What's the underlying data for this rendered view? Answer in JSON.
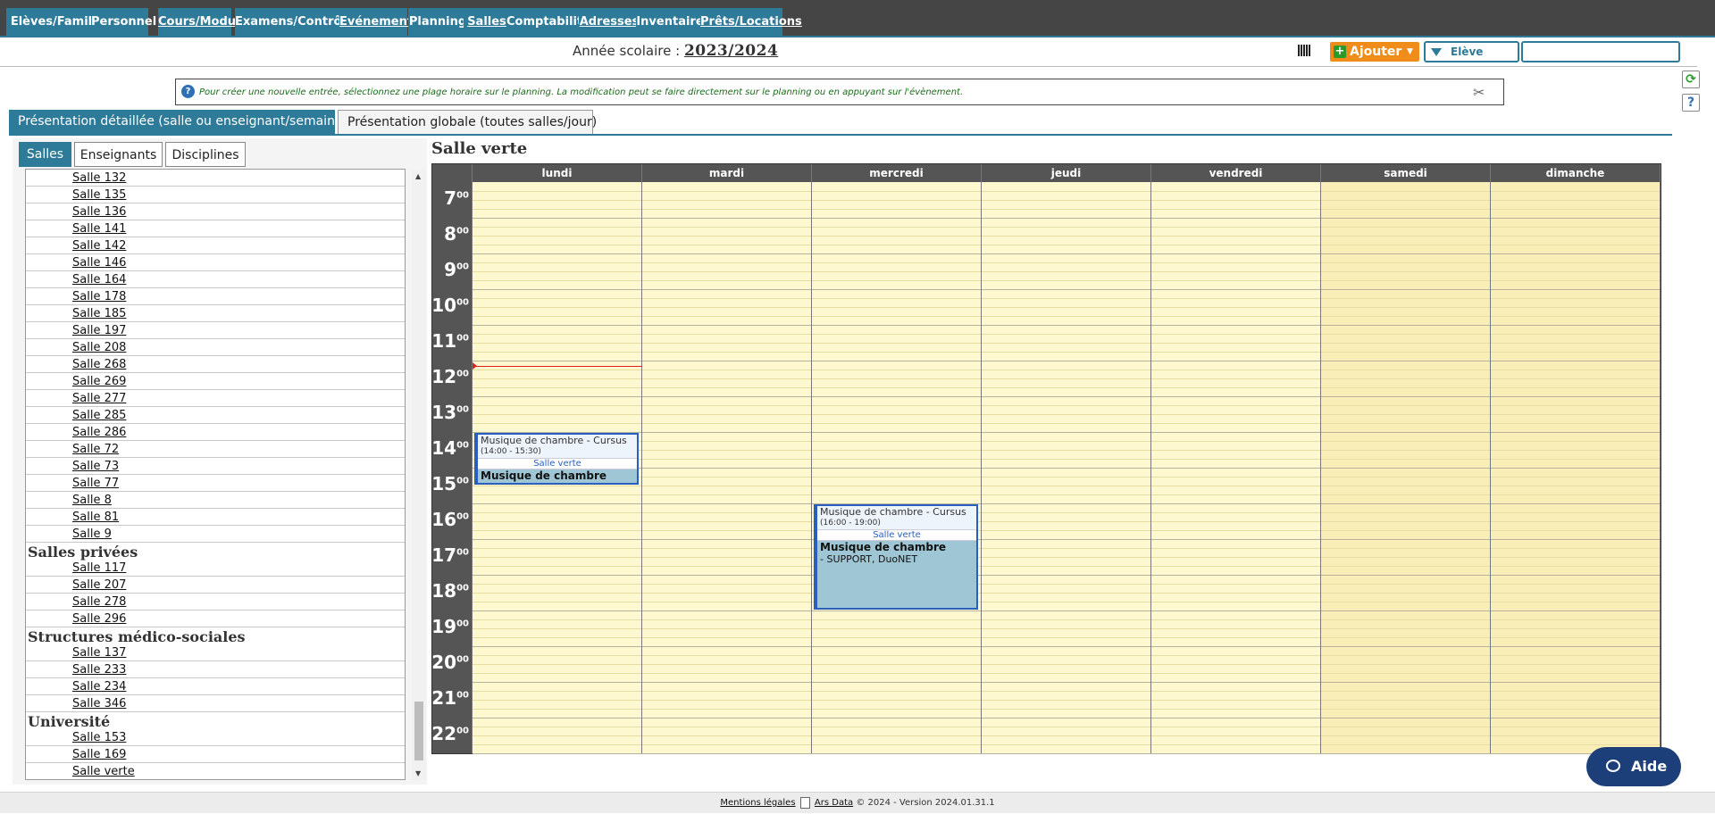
{
  "nav": {
    "tabs": [
      {
        "label": "Elèves/Familles",
        "underline": false
      },
      {
        "label": "Personnel",
        "underline": false
      },
      {
        "label": "Cours/Modules",
        "underline": true
      },
      {
        "label": "Examens/Contrôles",
        "underline": false
      },
      {
        "label": "Evénements",
        "underline": true
      },
      {
        "label": "Planning",
        "underline": false
      },
      {
        "label": "Salles",
        "underline": true
      },
      {
        "label": "Comptabilité",
        "underline": false
      },
      {
        "label": "Adresses",
        "underline": true
      },
      {
        "label": "Inventaire",
        "underline": false
      },
      {
        "label": "Prêts/Locations",
        "underline": true
      }
    ]
  },
  "header": {
    "year_label": "Année scolaire :",
    "year_value": "2023/2024",
    "add_label": "Ajouter",
    "search_type": "Elève",
    "search_value": ""
  },
  "info": {
    "text": "Pour créer une nouvelle entrée, sélectionnez une plage horaire sur le planning. La modification peut se faire directement sur le planning ou en appuyant sur l'évènement."
  },
  "view_tabs": {
    "detailed": "Présentation détaillée (salle ou enseignant/semaine)",
    "global": "Présentation globale (toutes salles/jour)"
  },
  "side_tabs": {
    "rooms": "Salles",
    "teachers": "Enseignants",
    "disciplines": "Disciplines"
  },
  "room_list": [
    {
      "type": "room",
      "label": "Salle 132"
    },
    {
      "type": "room",
      "label": "Salle 135"
    },
    {
      "type": "room",
      "label": "Salle 136"
    },
    {
      "type": "room",
      "label": "Salle 141"
    },
    {
      "type": "room",
      "label": "Salle 142"
    },
    {
      "type": "room",
      "label": "Salle 146"
    },
    {
      "type": "room",
      "label": "Salle 164"
    },
    {
      "type": "room",
      "label": "Salle 178"
    },
    {
      "type": "room",
      "label": "Salle 185"
    },
    {
      "type": "room",
      "label": "Salle 197"
    },
    {
      "type": "room",
      "label": "Salle 208"
    },
    {
      "type": "room",
      "label": "Salle 268"
    },
    {
      "type": "room",
      "label": "Salle 269"
    },
    {
      "type": "room",
      "label": "Salle 277"
    },
    {
      "type": "room",
      "label": "Salle 285"
    },
    {
      "type": "room",
      "label": "Salle 286"
    },
    {
      "type": "room",
      "label": "Salle 72"
    },
    {
      "type": "room",
      "label": "Salle 73"
    },
    {
      "type": "room",
      "label": "Salle 77"
    },
    {
      "type": "room",
      "label": "Salle 8"
    },
    {
      "type": "room",
      "label": "Salle 81"
    },
    {
      "type": "room",
      "label": "Salle 9"
    },
    {
      "type": "group",
      "label": "Salles privées"
    },
    {
      "type": "room",
      "label": "Salle 117"
    },
    {
      "type": "room",
      "label": "Salle 207"
    },
    {
      "type": "room",
      "label": "Salle 278"
    },
    {
      "type": "room",
      "label": "Salle 296"
    },
    {
      "type": "group",
      "label": "Structures médico-sociales"
    },
    {
      "type": "room",
      "label": "Salle 137"
    },
    {
      "type": "room",
      "label": "Salle 233"
    },
    {
      "type": "room",
      "label": "Salle 234"
    },
    {
      "type": "room",
      "label": "Salle 346"
    },
    {
      "type": "group",
      "label": "Université"
    },
    {
      "type": "room",
      "label": "Salle 153"
    },
    {
      "type": "room",
      "label": "Salle 169"
    },
    {
      "type": "room",
      "label": "Salle verte"
    }
  ],
  "calendar": {
    "title": "Salle verte",
    "days": [
      "lundi",
      "mardi",
      "mercredi",
      "jeudi",
      "vendredi",
      "samedi",
      "dimanche"
    ],
    "hours": [
      "7",
      "8",
      "9",
      "10",
      "11",
      "12",
      "13",
      "14",
      "15",
      "16",
      "17",
      "18",
      "19",
      "20",
      "21",
      "22"
    ],
    "minutes_label": "00",
    "now": {
      "day": 0,
      "hour": 12.15
    },
    "events": [
      {
        "day": 0,
        "start": 14.0,
        "end": 15.5,
        "title": "Musique de chambre - Cursus",
        "time": "(14:00 - 15:30)",
        "room": "Salle verte",
        "subject": "Musique de chambre",
        "detail": ""
      },
      {
        "day": 2,
        "start": 16.0,
        "end": 19.0,
        "title": "Musique de chambre - Cursus",
        "time": "(16:00 - 19:00)",
        "room": "Salle verte",
        "subject": "Musique de chambre",
        "detail": "- SUPPORT, DuoNET"
      }
    ]
  },
  "footer": {
    "legal": "Mentions légales",
    "brand": "Ars Data",
    "rest": "© 2024 - Version 2024.01.31.1"
  },
  "help": {
    "label": "Aide"
  },
  "colors": {
    "accent": "#2e7a99",
    "nav_bg": "#454545",
    "add": "#f08c1a",
    "help": "#1c3f7a",
    "calendar_bg": "#fdf8cf"
  }
}
